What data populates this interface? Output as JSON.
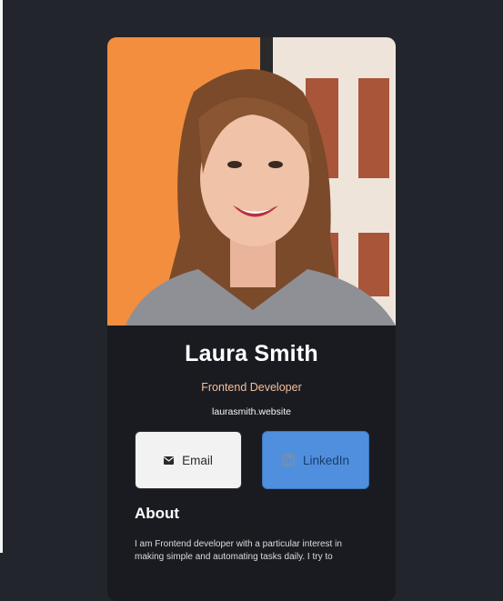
{
  "profile": {
    "name": "Laura Smith",
    "title": "Frontend Developer",
    "website": "laurasmith.website",
    "photo_alt": "portrait-photo"
  },
  "buttons": {
    "email_label": "Email",
    "email_icon": "envelope-icon",
    "linkedin_label": "LinkedIn",
    "linkedin_icon": "linkedin-icon"
  },
  "about": {
    "heading": "About",
    "text": "I am Frontend developer with a particular interest in making simple and automating tasks daily. I try to"
  },
  "colors": {
    "background": "#23252c",
    "card": "#1a1b21",
    "accent": "#f3bf99",
    "linkedin": "#4f8fde"
  }
}
